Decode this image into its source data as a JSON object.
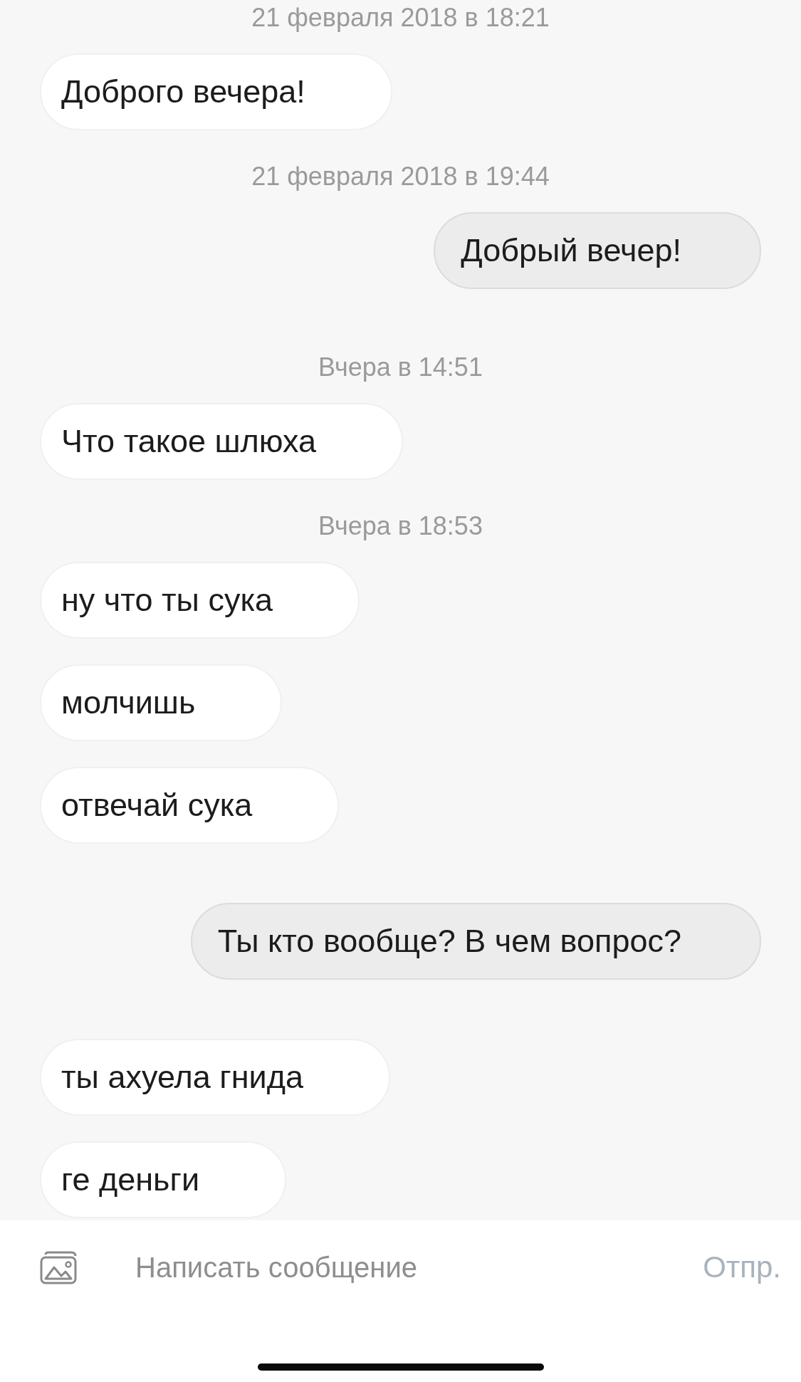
{
  "messages": [
    {
      "kind": "timestamp",
      "text": "21 февраля 2018 в 18:21"
    },
    {
      "kind": "incoming",
      "text": "Доброго вечера!"
    },
    {
      "kind": "timestamp",
      "text": "21 февраля 2018 в 19:44"
    },
    {
      "kind": "outgoing",
      "text": "Добрый вечер!"
    },
    {
      "kind": "timestamp",
      "text": "Вчера в 14:51"
    },
    {
      "kind": "incoming",
      "text": "Что такое шлюха"
    },
    {
      "kind": "timestamp",
      "text": "Вчера в 18:53"
    },
    {
      "kind": "incoming",
      "text": "ну что ты сука"
    },
    {
      "kind": "incoming",
      "text": "молчишь"
    },
    {
      "kind": "incoming",
      "text": "отвечай сука"
    },
    {
      "kind": "outgoing",
      "text": "Ты кто вообще? В чем вопрос?"
    },
    {
      "kind": "incoming",
      "text": "ты ахуела гнида"
    },
    {
      "kind": "incoming",
      "text": "ге деньги"
    }
  ],
  "composer": {
    "placeholder": "Написать сообщение",
    "send_label": "Отпр."
  }
}
